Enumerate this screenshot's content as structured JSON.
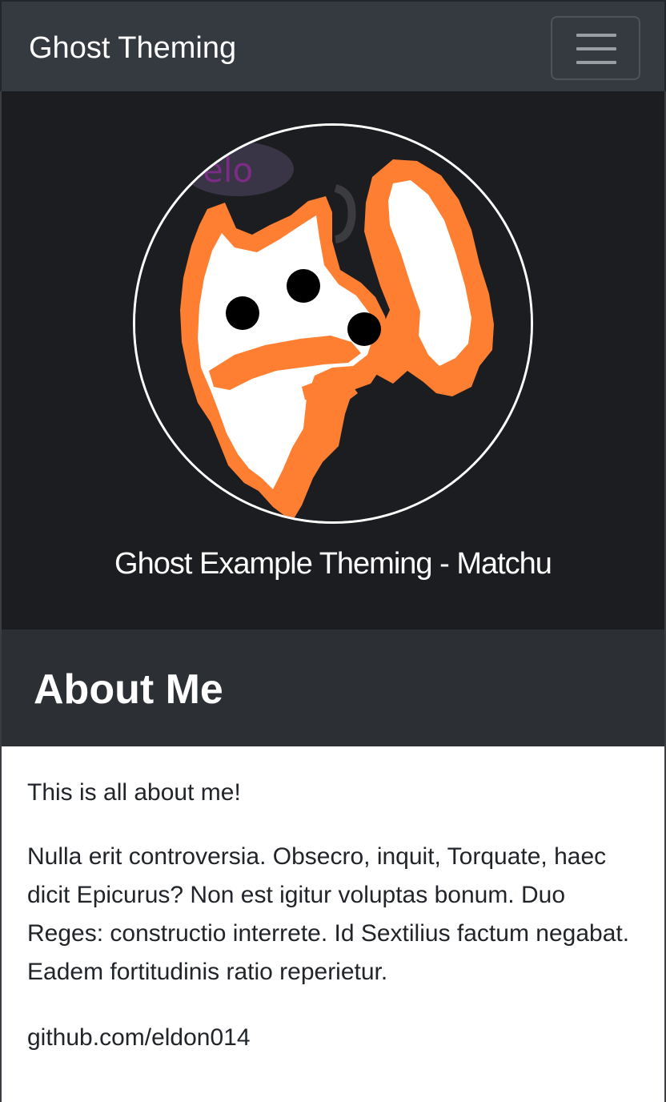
{
  "navbar": {
    "brand": "Ghost Theming"
  },
  "hero": {
    "avatar_overlay_text": "elo",
    "tagline": "Ghost Example Theming - Matchu"
  },
  "about": {
    "heading": "About Me",
    "intro": "This is all about me!",
    "body": "Nulla erit controversia. Obsecro, inquit, Torquate, haec dicit Epicurus? Non est igitur voluptas bonum. Duo Reges: constructio interrete. Id Sextilius factum negabat. Eadem fortitudinis ratio reperietur.",
    "link": "github.com/eldon014"
  },
  "colors": {
    "navbar_bg": "#343a40",
    "hero_bg": "#1c1d20",
    "section_head_bg": "#2c3035",
    "accent_orange": "#fe7f31",
    "text_dark": "#212529"
  },
  "icons": {
    "menu": "hamburger-icon"
  }
}
